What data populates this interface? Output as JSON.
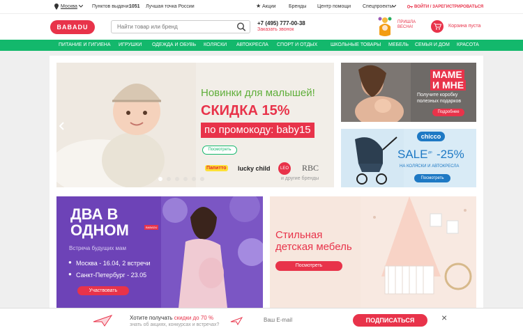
{
  "topbar": {
    "city": "Москва",
    "pickup_label": "Пунктов выдачи:",
    "pickup_count": "1051",
    "best_point": "Лучшая точка России",
    "promos": "Акции",
    "brands": "Бренды",
    "help": "Центр помощи",
    "special": "Спецпроекты",
    "login": "ВОЙТИ / ЗАРЕГИСТРИРОВАТЬСЯ"
  },
  "header": {
    "logo": "BABADU",
    "search_placeholder": "Найти товар или бренд",
    "phone": "+7 (495) 777-00-38",
    "callback": "Заказать звонок",
    "spring_line1": "ПРИШЛА",
    "spring_line2": "ВЕСНА!",
    "cart": "Корзина пуста"
  },
  "nav": [
    "ПИТАНИЕ И ГИГИЕНА",
    "ИГРУШКИ",
    "ОДЕЖДА И ОБУВЬ",
    "КОЛЯСКИ",
    "АВТОКРЕСЛА",
    "СПОРТ И ОТДЫХ",
    "ШКОЛЬНЫЕ ТОВАРЫ",
    "МЕБЕЛЬ",
    "СЕМЬЯ И ДОМ",
    "КРАСОТА"
  ],
  "banner_main": {
    "title": "Новинки для малышей!",
    "discount": "СКИДКА 15%",
    "promo": "по промокоду: baby15",
    "button": "Посмотреть",
    "brand1": "lucky child",
    "brand2": "LEO",
    "brand3": "RBC",
    "brand0": "Папитто",
    "brands_more": "и другие бренды"
  },
  "banner_mom": {
    "title1": "МАМЕ",
    "title2": "И МНЕ",
    "text1": "Получите коробку",
    "text2": "полезных подарков",
    "button": "Подробнее"
  },
  "banner_chicco": {
    "logo": "chicco",
    "sale": "SALE",
    "upto": "до",
    "percent": "-25%",
    "text": "НА КОЛЯСКИ И АВТОКРЕСЛА",
    "button": "Посмотреть"
  },
  "banner_event": {
    "title1": "ДВА В",
    "title2": "ОДНОМ",
    "badge": "BABADU",
    "subtitle": "Встреча будущих мам",
    "place1": "Москва - 16.04, 2 встречи",
    "place2": "Санкт-Петербург - 23.05",
    "button": "Участвовать"
  },
  "banner_furniture": {
    "title1": "Стильная",
    "title2": "детская мебель",
    "button": "Посмотреть"
  },
  "subscribe": {
    "text1": "Хотите получать",
    "text_highlight": "скидки до 70 %",
    "text2": "знать об акциях, конкурсах и встречах?",
    "placeholder": "Ваш E-mail",
    "button": "ПОДПИСАТЬСЯ",
    "close": "×"
  },
  "colors": {
    "brand_red": "#e8334a",
    "nav_green": "#13b86c",
    "event_purple": "#6d43b7",
    "chicco_blue": "#1e79c4"
  },
  "carousel": {
    "dots": 6,
    "active": 0
  }
}
